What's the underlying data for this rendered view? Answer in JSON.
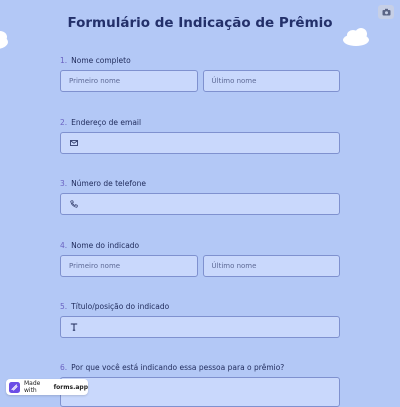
{
  "form": {
    "title": "Formulário de Indicação de Prêmio"
  },
  "questions": [
    {
      "number": "1.",
      "label": "Nome completo",
      "fields": [
        {
          "placeholder": "Primeiro nome"
        },
        {
          "placeholder": "Último nome"
        }
      ]
    },
    {
      "number": "2.",
      "label": "Endereço de email",
      "icon": "envelope-icon"
    },
    {
      "number": "3.",
      "label": "Número de telefone",
      "icon": "phone-icon"
    },
    {
      "number": "4.",
      "label": "Nome do indicado",
      "fields": [
        {
          "placeholder": "Primeiro nome"
        },
        {
          "placeholder": "Último nome"
        }
      ]
    },
    {
      "number": "5.",
      "label": "Título/posição do indicado",
      "icon": "text-icon"
    },
    {
      "number": "6.",
      "label": "Por que você está indicando essa pessoa para o prêmio?"
    }
  ],
  "badge": {
    "prefix": "Made with",
    "brand": "forms.app"
  },
  "top_icon": "camera-icon",
  "colors": {
    "background": "#b3c8f6",
    "field_fill": "#c9d8fc",
    "field_border": "#7f91cf",
    "title": "#23306a",
    "number": "#6b63c2"
  }
}
